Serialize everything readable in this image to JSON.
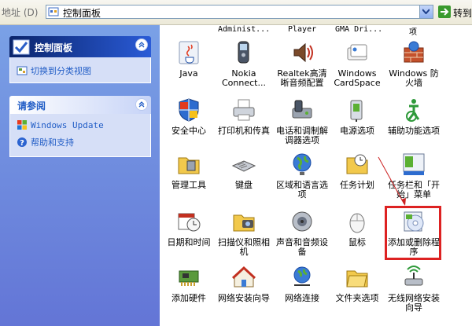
{
  "address_bar": {
    "label": "地址 (D)",
    "value": "控制面板",
    "go_label": "转到"
  },
  "left_pane": {
    "panel_main": {
      "title": "控制面板",
      "link": "切换到分类视图"
    },
    "panel_see_also": {
      "title": "请参阅",
      "links": [
        "Windows Update",
        "帮助和支持"
      ]
    }
  },
  "top_row_partial": [
    "Administ...",
    "Player",
    "GMA Dri...",
    "项"
  ],
  "items": [
    {
      "label": "Java",
      "icon": "java-icon"
    },
    {
      "label": "Nokia Connect...",
      "icon": "nokia-phone-icon"
    },
    {
      "label": "Realtek高清晰音频配置",
      "icon": "speaker-icon"
    },
    {
      "label": "Windows CardSpace",
      "icon": "cardspace-icon"
    },
    {
      "label": "Windows 防火墙",
      "icon": "firewall-icon"
    },
    {
      "label": "安全中心",
      "icon": "security-shield-icon"
    },
    {
      "label": "打印机和传真",
      "icon": "printer-icon"
    },
    {
      "label": "电话和调制解调器选项",
      "icon": "phone-modem-icon"
    },
    {
      "label": "电源选项",
      "icon": "power-plug-icon"
    },
    {
      "label": "辅助功能选项",
      "icon": "accessibility-icon"
    },
    {
      "label": "管理工具",
      "icon": "admin-tools-icon"
    },
    {
      "label": "键盘",
      "icon": "keyboard-icon"
    },
    {
      "label": "区域和语言选项",
      "icon": "globe-icon"
    },
    {
      "label": "任务计划",
      "icon": "task-folder-icon"
    },
    {
      "label": "任务栏和「开始」菜单",
      "icon": "taskbar-icon"
    },
    {
      "label": "日期和时间",
      "icon": "calendar-clock-icon"
    },
    {
      "label": "扫描仪和照相机",
      "icon": "scanner-camera-icon"
    },
    {
      "label": "声音和音频设备",
      "icon": "sound-speaker-icon"
    },
    {
      "label": "鼠标",
      "icon": "mouse-icon"
    },
    {
      "label": "添加或删除程序",
      "icon": "add-remove-programs-icon"
    },
    {
      "label": "添加硬件",
      "icon": "add-hardware-icon"
    },
    {
      "label": "网络安装向导",
      "icon": "network-home-icon"
    },
    {
      "label": "网络连接",
      "icon": "network-globe-icon"
    },
    {
      "label": "文件夹选项",
      "icon": "folder-options-icon"
    },
    {
      "label": "无线网络安装向导",
      "icon": "wireless-icon"
    }
  ],
  "colors": {
    "highlight_box": "#dd2222",
    "link": "#215dc6",
    "left_pane_top": "#7aa1e6",
    "left_pane_bottom": "#6375d6"
  }
}
